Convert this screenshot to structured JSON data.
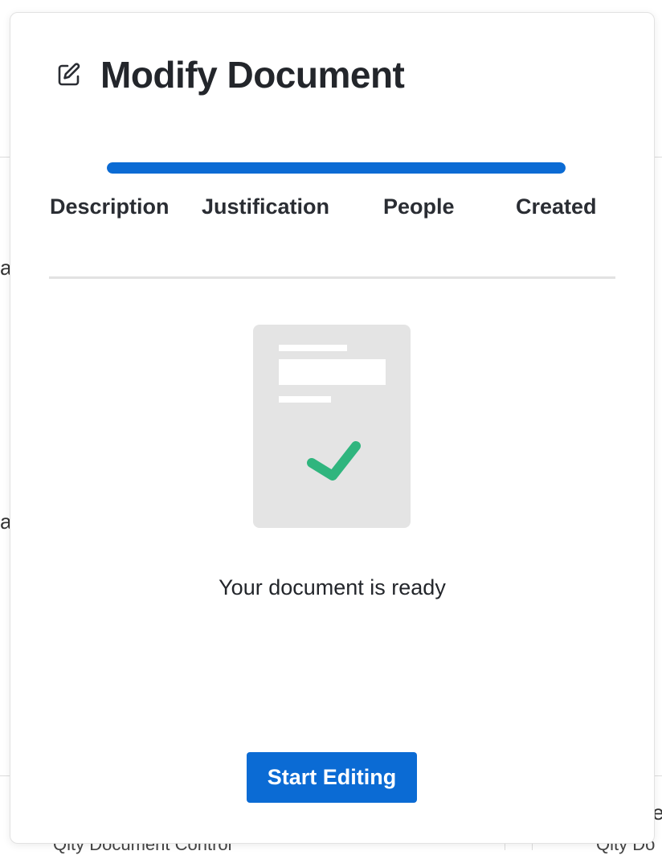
{
  "modal": {
    "title": "Modify Document",
    "icon": "edit-icon",
    "progress_percent": 100,
    "steps": [
      {
        "label": "Description"
      },
      {
        "label": "Justification"
      },
      {
        "label": "People"
      },
      {
        "label": "Created"
      }
    ],
    "illustration_icon": "document-check-icon",
    "message": "Your document is ready",
    "primary_button": "Start Editing"
  },
  "background": {
    "bottom_left_text": "Qity Document Control",
    "bottom_right_text": "Qity Do",
    "fragment_a": "a",
    "fragment_e": "e"
  },
  "colors": {
    "accent": "#0b6bd4",
    "check": "#2fb57e",
    "illustration_bg": "#e4e4e4",
    "text": "#23262b"
  }
}
